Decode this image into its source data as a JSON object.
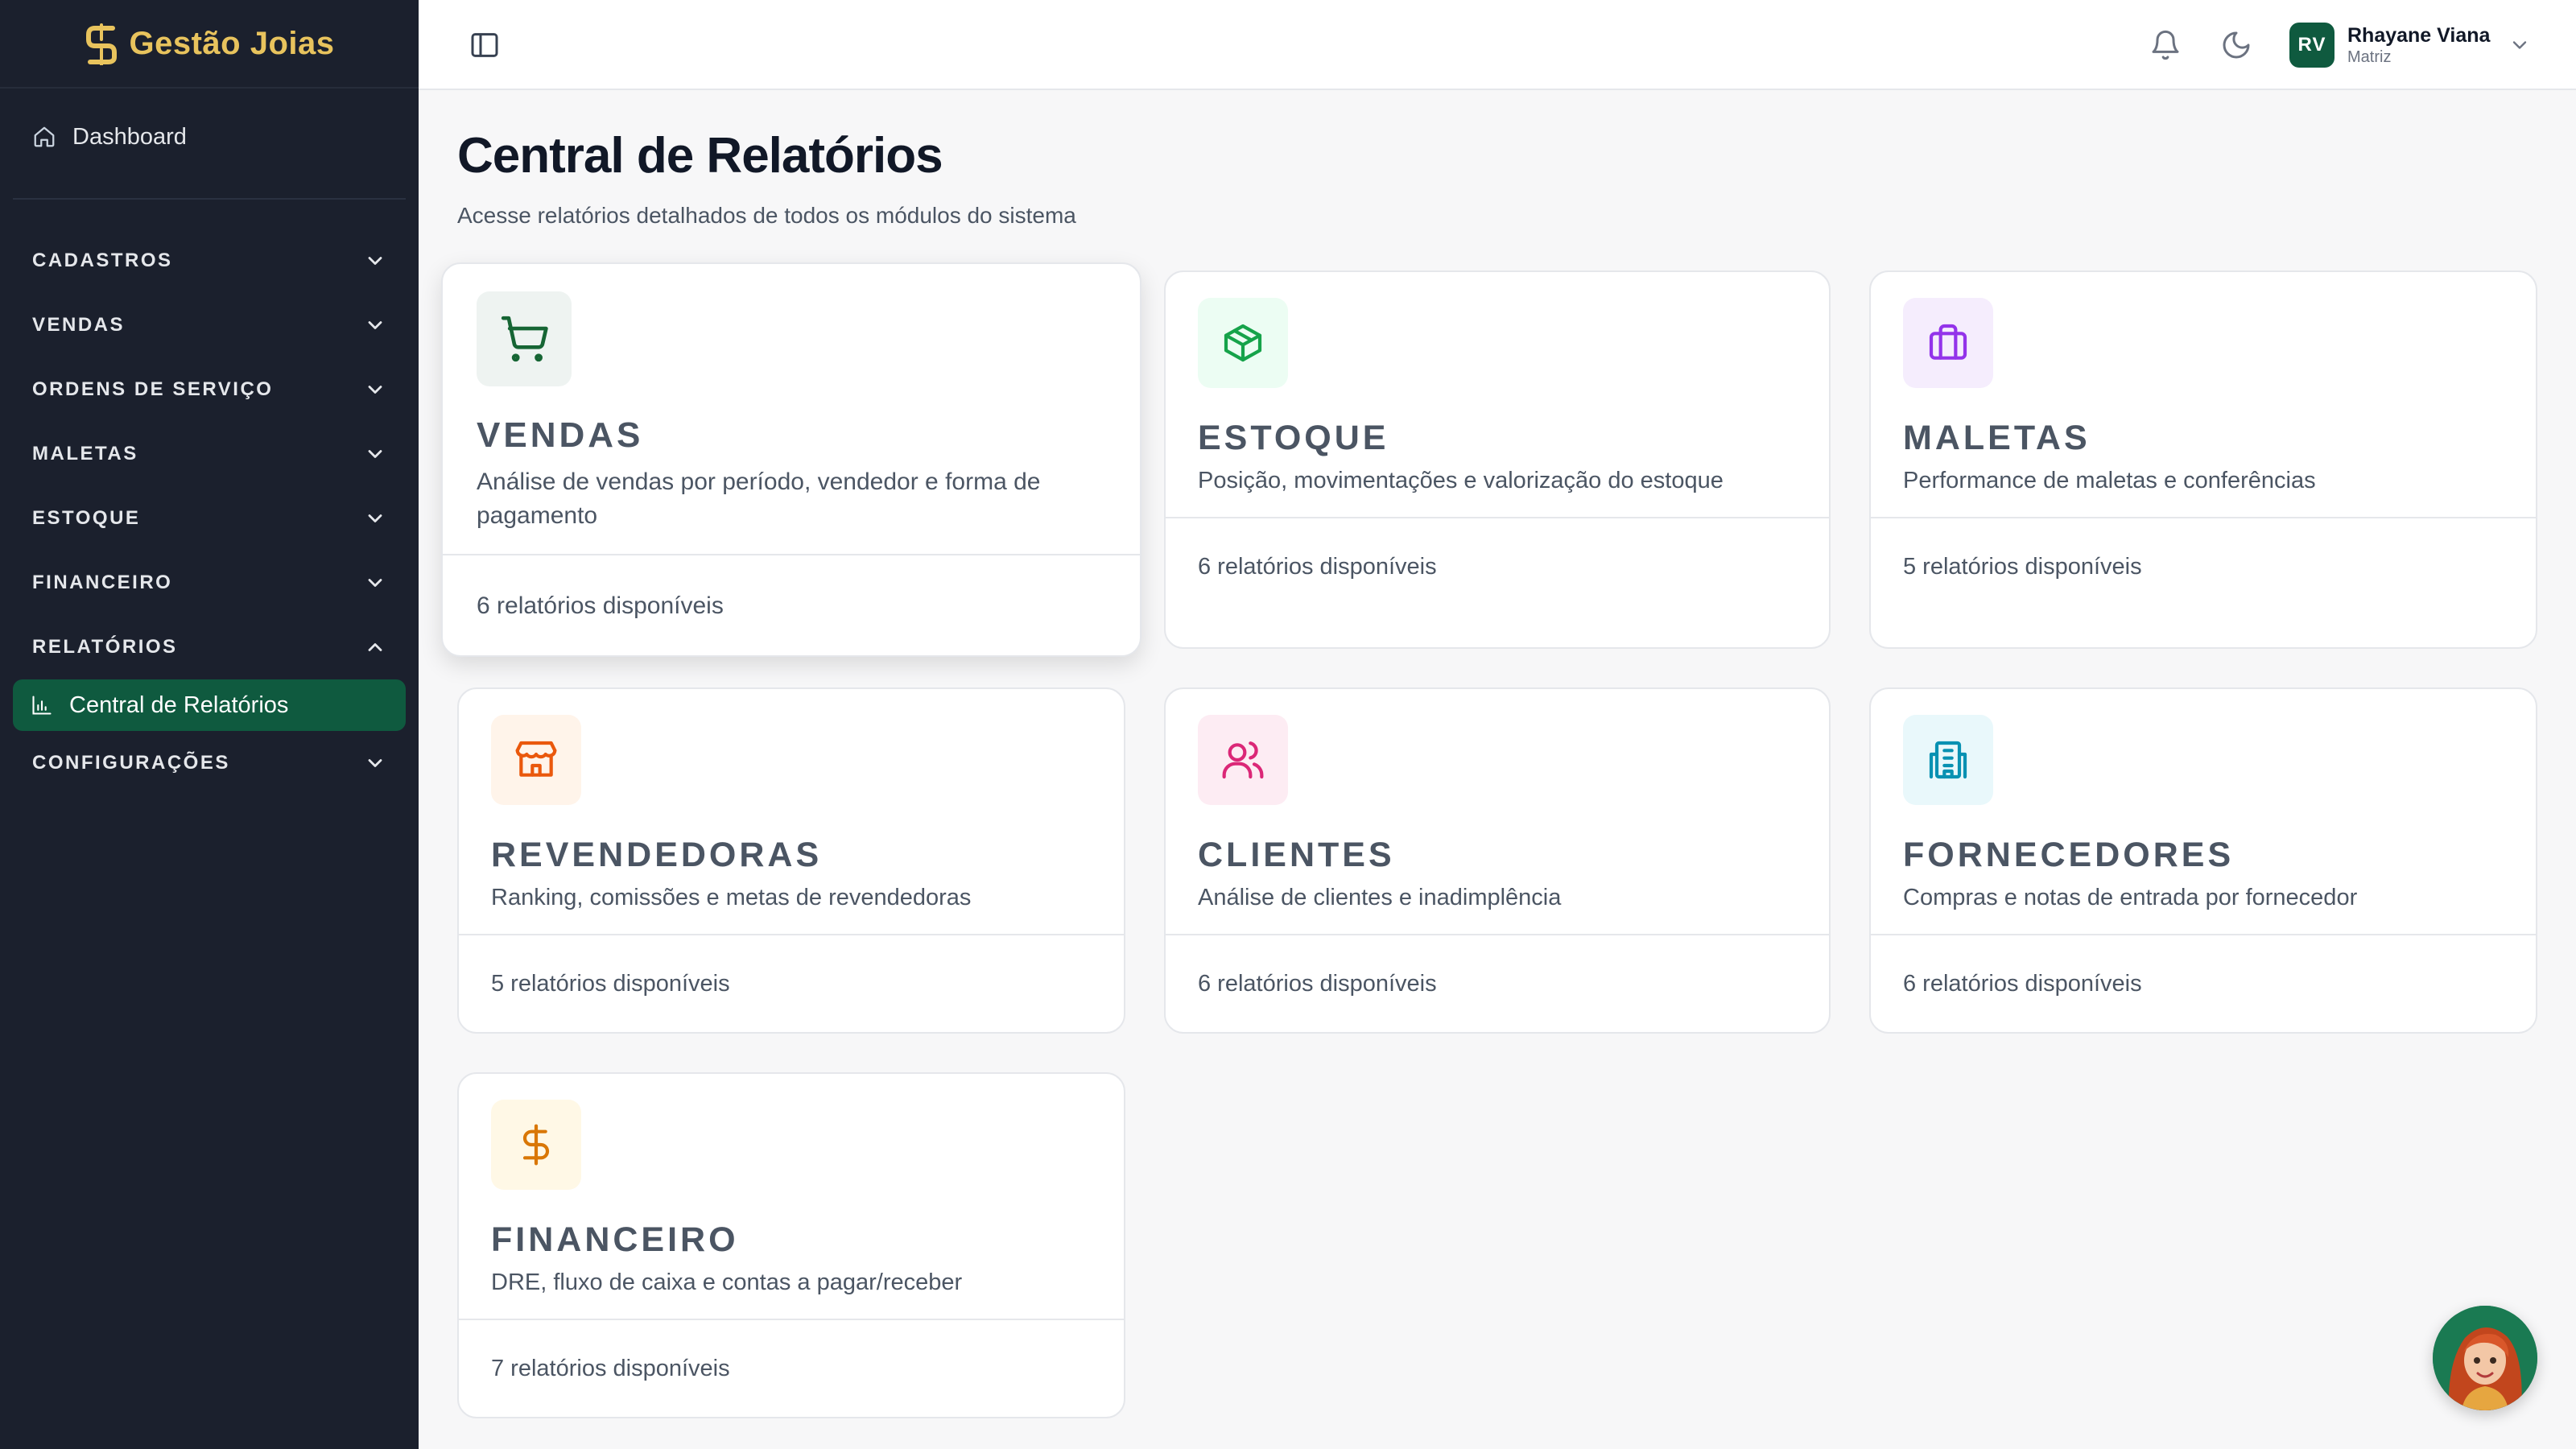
{
  "brand": {
    "name": "Gestão Joias",
    "color": "#e8c35d"
  },
  "sidebar": {
    "dashboard": "Dashboard",
    "groups": [
      {
        "label": "CADASTROS",
        "expanded": false
      },
      {
        "label": "VENDAS",
        "expanded": false
      },
      {
        "label": "ORDENS DE SERVIÇO",
        "expanded": false
      },
      {
        "label": "MALETAS",
        "expanded": false
      },
      {
        "label": "ESTOQUE",
        "expanded": false
      },
      {
        "label": "FINANCEIRO",
        "expanded": false
      },
      {
        "label": "RELATÓRIOS",
        "expanded": true
      },
      {
        "label": "CONFIGURAÇÕES",
        "expanded": false
      }
    ],
    "active_item": "Central de Relatórios"
  },
  "header": {
    "user_initials": "RV",
    "user_name": "Rhayane Viana",
    "user_role": "Matriz"
  },
  "page": {
    "title": "Central de Relatórios",
    "subtitle": "Acesse relatórios detalhados de todos os módulos do sistema"
  },
  "cards": [
    {
      "title": "VENDAS",
      "desc_1": "Análise de vendas por período, vendedor e forma de",
      "desc_2": "pagamento",
      "footer": "6 relatórios disponíveis",
      "icon": "shopping-cart-icon",
      "color": "#166534"
    },
    {
      "title": "ESTOQUE",
      "desc_1": "Posição, movimentações e valorização do estoque",
      "footer": "6 relatórios disponíveis",
      "icon": "package-icon",
      "color": "#16a34a"
    },
    {
      "title": "MALETAS",
      "desc_1": "Performance de maletas e conferências",
      "footer": "5 relatórios disponíveis",
      "icon": "briefcase-icon",
      "color": "#9333ea"
    },
    {
      "title": "REVENDEDORAS",
      "desc_1": "Ranking, comissões e metas de revendedoras",
      "footer": "5 relatórios disponíveis",
      "icon": "store-icon",
      "color": "#ea580c"
    },
    {
      "title": "CLIENTES",
      "desc_1": "Análise de clientes e inadimplência",
      "footer": "6 relatórios disponíveis",
      "icon": "users-icon",
      "color": "#db2777"
    },
    {
      "title": "FORNECEDORES",
      "desc_1": "Compras e notas de entrada por fornecedor",
      "footer": "6 relatórios disponíveis",
      "icon": "building-icon",
      "color": "#0891b2"
    },
    {
      "title": "FINANCEIRO",
      "desc_1": "DRE, fluxo de caixa e contas a pagar/receber",
      "footer": "7 relatórios disponíveis",
      "icon": "dollar-icon",
      "color": "#d97706"
    }
  ]
}
